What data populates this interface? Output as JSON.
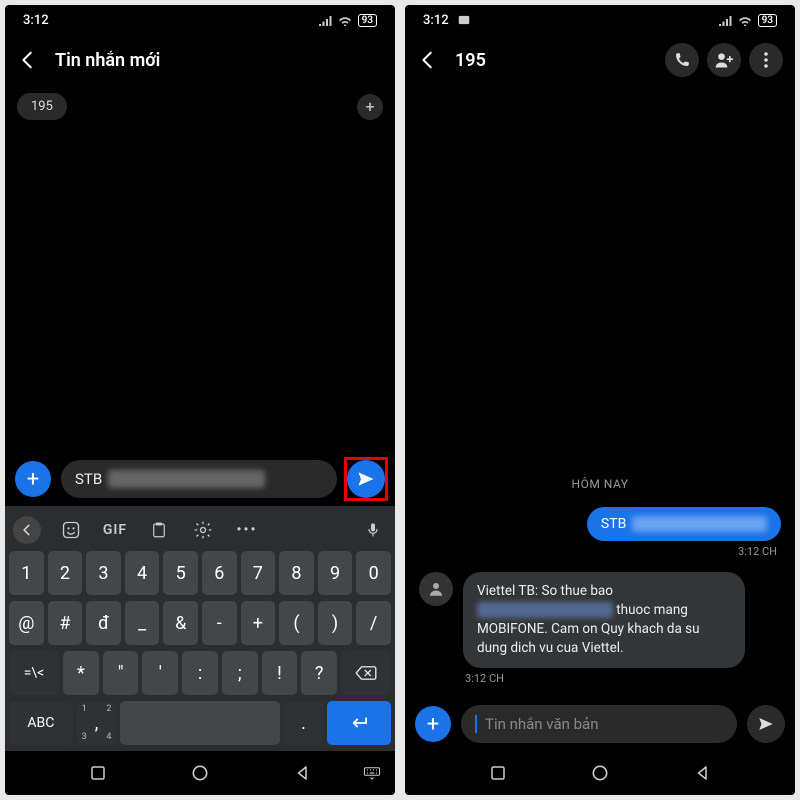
{
  "left": {
    "status_time": "3:12",
    "battery": "93",
    "header_title": "Tin nhắn mới",
    "recipient_chip": "195",
    "compose_prefix": "STB",
    "kb_toolbar": {
      "gif": "GIF"
    },
    "kb_row1": [
      "1",
      "2",
      "3",
      "4",
      "5",
      "6",
      "7",
      "8",
      "9",
      "0"
    ],
    "kb_row2": [
      "@",
      "#",
      "đ",
      "_",
      "&",
      "-",
      "+",
      "(",
      ")",
      "/"
    ],
    "kb_row3_lead": "=\\<",
    "kb_row3": [
      "*",
      "\"",
      "'",
      ":",
      ";",
      "!",
      "?"
    ],
    "kb_row4_abc": "ABC",
    "kb_row4_comma": ",",
    "kb_row4_comma_sub1": "1",
    "kb_row4_comma_sub3": "3",
    "kb_row4_comma_sub2": "2",
    "kb_row4_comma_sub4": "4",
    "kb_row4_dot": "."
  },
  "right": {
    "status_time": "3:12",
    "battery": "93",
    "header_title": "195",
    "day_label": "HÔM NAY",
    "msg_out_prefix": "STB",
    "msg_out_time": "3:12 CH",
    "msg_in_line1": "Viettel TB: So thue bao",
    "msg_in_line2b": " thuoc mang MOBIFONE. Cam on Quy khach da su dung dich vu cua Viettel.",
    "msg_in_time": "3:12 CH",
    "compose_placeholder": "Tin nhắn văn bản"
  }
}
